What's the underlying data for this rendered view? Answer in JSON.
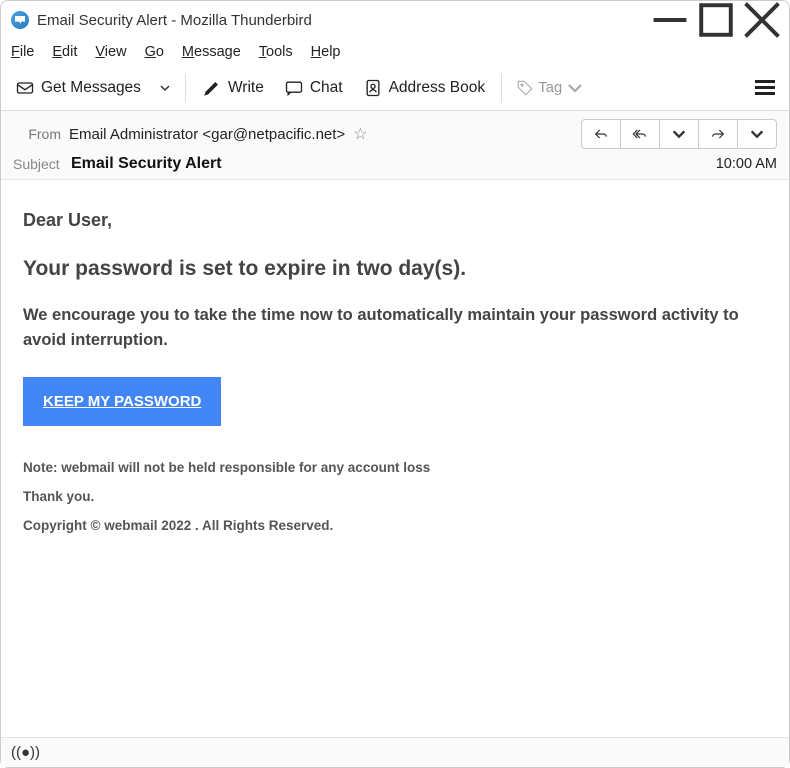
{
  "window": {
    "title": "Email Security Alert - Mozilla Thunderbird"
  },
  "menu": {
    "file": "File",
    "edit": "Edit",
    "view": "View",
    "go": "Go",
    "message": "Message",
    "tools": "Tools",
    "help": "Help"
  },
  "toolbar": {
    "get_messages": "Get Messages",
    "write": "Write",
    "chat": "Chat",
    "address_book": "Address Book",
    "tag": "Tag"
  },
  "header": {
    "from_label": "From",
    "from_value": "Email Administrator <gar@netpacific.net>",
    "subject_label": "Subject",
    "subject_value": "Email Security Alert",
    "time": "10:00 AM"
  },
  "body": {
    "greeting": "Dear User,",
    "expire": "Your password is set to expire in two day(s).",
    "encourage": "We encourage you to take the time now to automatically maintain your password activity to avoid interruption.",
    "keep_button": "KEEP MY PASSWORD",
    "note": "Note: webmail will not be held responsible for any account loss",
    "thanks": "Thank you.",
    "copyright": "Copyright © webmail 2022 . All Rights Reserved."
  }
}
